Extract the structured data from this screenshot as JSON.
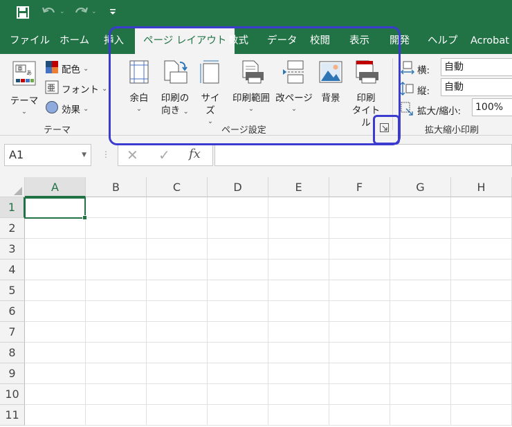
{
  "qat": {
    "save_icon": "save-icon",
    "undo_icon": "undo-icon",
    "redo_icon": "redo-icon",
    "customize_icon": "customize-qat-icon"
  },
  "tabs": [
    {
      "label": "ファイル"
    },
    {
      "label": "ホーム"
    },
    {
      "label": "挿入"
    },
    {
      "label": "ページ レイアウト",
      "active": true
    },
    {
      "label": "数式"
    },
    {
      "label": "データ"
    },
    {
      "label": "校閲"
    },
    {
      "label": "表示"
    },
    {
      "label": "開発"
    },
    {
      "label": "ヘルプ"
    },
    {
      "label": "Acrobat"
    }
  ],
  "ribbon": {
    "theme_group": {
      "label": "テーマ",
      "theme_button": "テーマ",
      "colors": "配色",
      "fonts": "フォント",
      "effects": "効果"
    },
    "page_setup_group": {
      "label": "ページ設定",
      "margins": "余白",
      "orientation_line1": "印刷の",
      "orientation_line2": "向き",
      "size": "サイズ",
      "print_area": "印刷範囲",
      "breaks": "改ページ",
      "background": "背景",
      "print_titles_line1": "印刷",
      "print_titles_line2": "タイトル",
      "launcher_icon": "dialog-launcher-icon"
    },
    "scale_group": {
      "label": "拡大縮小印刷",
      "width_label": "横:",
      "width_value": "自動",
      "height_label": "縦:",
      "height_value": "自動",
      "scale_label": "拡大/縮小:",
      "scale_value": "100%"
    }
  },
  "formula_bar": {
    "name_box": "A1",
    "cancel_icon": "cancel-icon",
    "enter_icon": "enter-icon",
    "fx_label": "fx",
    "formula": ""
  },
  "grid": {
    "columns": [
      "A",
      "B",
      "C",
      "D",
      "E",
      "F",
      "G",
      "H"
    ],
    "rows": [
      "1",
      "2",
      "3",
      "4",
      "5",
      "6",
      "7",
      "8",
      "9",
      "10",
      "11"
    ],
    "selected_cell": "A1"
  },
  "colors": {
    "excel_green": "#217346",
    "highlight": "#3b3bcf",
    "ribbon_bg": "#f3f3f3"
  }
}
